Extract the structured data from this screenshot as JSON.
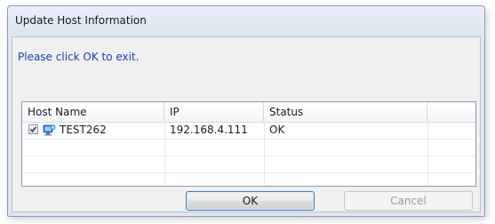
{
  "dialog": {
    "title": "Update Host Information",
    "message": "Please click OK to exit."
  },
  "table": {
    "columns": [
      "Host Name",
      "IP",
      "Status",
      ""
    ],
    "rows": [
      {
        "checked": true,
        "host_icon": "network-host-icon",
        "host_name": "TEST262",
        "ip": "192.168.4.111",
        "status": "OK"
      }
    ]
  },
  "buttons": {
    "ok_label": "OK",
    "cancel_label": "Cancel",
    "cancel_enabled": false
  },
  "colors": {
    "message_text": "#1d3fb8",
    "ok_border": "#3c7fb1",
    "disabled_text": "#9c9c9c"
  }
}
